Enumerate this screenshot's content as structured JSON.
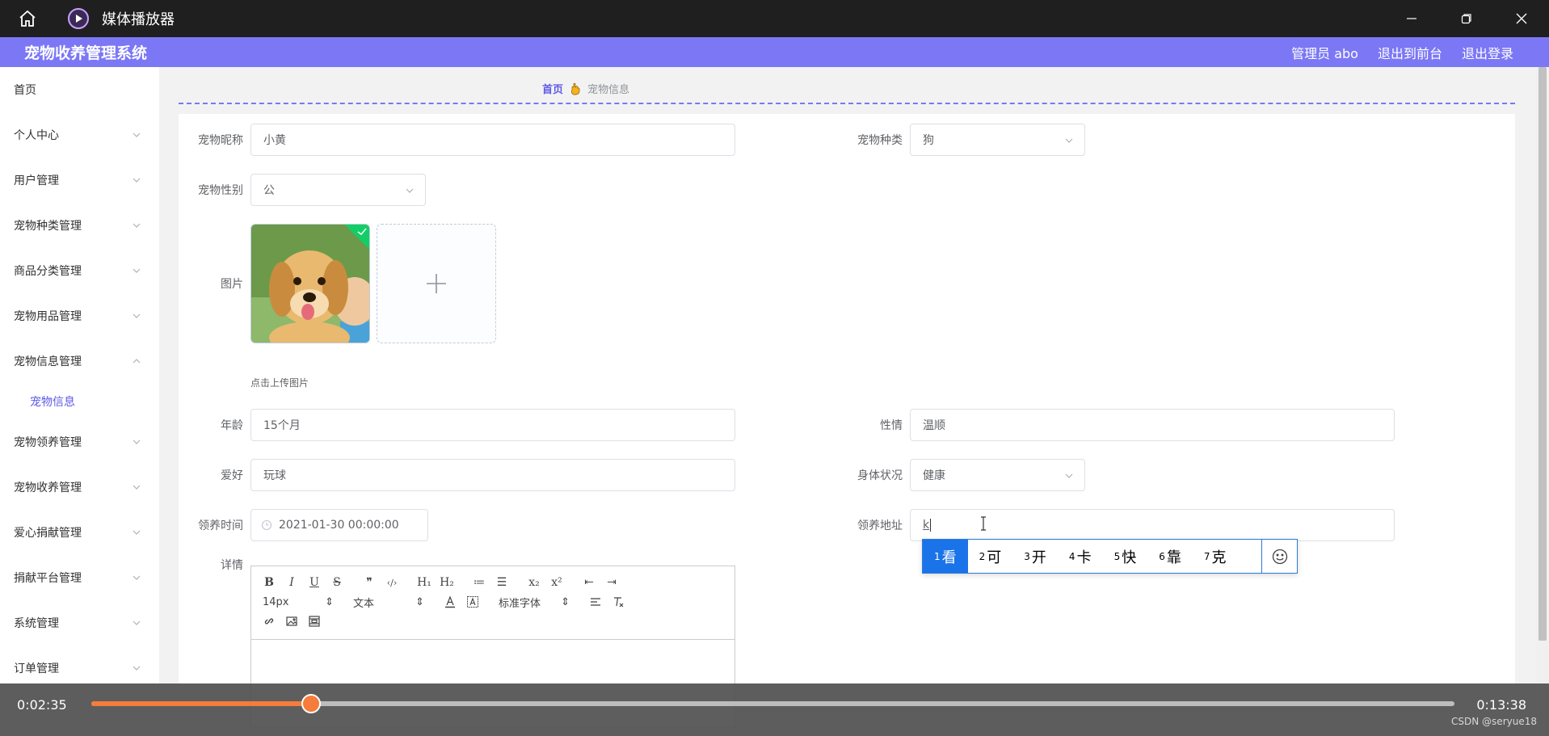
{
  "player": {
    "title": "媒体播放器",
    "current_time": "0:02:35",
    "total_time": "0:13:38",
    "progress_percent": 16.1,
    "watermark": "CSDN @seryue18"
  },
  "header": {
    "title": "宠物收养管理系统",
    "admin_label": "管理员 abo",
    "to_front_label": "退出到前台",
    "logout_label": "退出登录"
  },
  "sidebar": {
    "items": [
      {
        "label": "首页"
      },
      {
        "label": "个人中心"
      },
      {
        "label": "用户管理"
      },
      {
        "label": "宠物种类管理"
      },
      {
        "label": "商品分类管理"
      },
      {
        "label": "宠物用品管理"
      },
      {
        "label": "宠物信息管理"
      },
      {
        "label": "宠物领养管理"
      },
      {
        "label": "宠物收养管理"
      },
      {
        "label": "爱心捐献管理"
      },
      {
        "label": "捐献平台管理"
      },
      {
        "label": "系统管理"
      },
      {
        "label": "订单管理"
      }
    ],
    "submenu": {
      "label": "宠物信息"
    }
  },
  "breadcrumb": {
    "home": "首页",
    "current": "宠物信息"
  },
  "form": {
    "nickname": {
      "label": "宠物昵称",
      "value": "小黄"
    },
    "species": {
      "label": "宠物种类",
      "value": "狗"
    },
    "gender": {
      "label": "宠物性别",
      "value": "公"
    },
    "image": {
      "label": "图片",
      "tip": "点击上传图片"
    },
    "age": {
      "label": "年龄",
      "value": "15个月"
    },
    "temperament": {
      "label": "性情",
      "value": "温顺"
    },
    "hobby": {
      "label": "爱好",
      "value": "玩球"
    },
    "health": {
      "label": "身体状况",
      "value": "健康"
    },
    "adopt_time": {
      "label": "领养时间",
      "value": "2021-01-30 00:00:00"
    },
    "adopt_address": {
      "label": "领养地址",
      "value": "k"
    },
    "detail": {
      "label": "详情"
    }
  },
  "editor": {
    "font_size": "14px",
    "text_style": "文本",
    "font_family": "标准字体",
    "buttons_row1": [
      "B",
      "I",
      "U",
      "S",
      "❞",
      "‹/›",
      "H₁",
      "H₂",
      "≔",
      "☰",
      "x₂",
      "x²",
      "⇤",
      "⇥"
    ]
  },
  "ime": {
    "candidates": [
      {
        "num": "1",
        "text": "看"
      },
      {
        "num": "2",
        "text": "可"
      },
      {
        "num": "3",
        "text": "开"
      },
      {
        "num": "4",
        "text": "卡"
      },
      {
        "num": "5",
        "text": "快"
      },
      {
        "num": "6",
        "text": "靠"
      },
      {
        "num": "7",
        "text": "克"
      }
    ]
  }
}
